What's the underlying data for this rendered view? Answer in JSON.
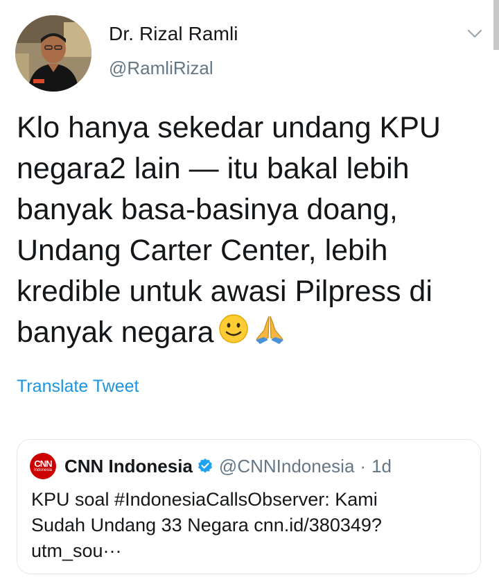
{
  "tweet": {
    "author_name": "Dr. Rizal Ramli",
    "author_handle": "@RamliRizal",
    "text": "Klo hanya sekedar undang KPU\nnegara2 lain — itu bakal lebih\nbanyak basa-basinya doang,\nUndang Carter Center, lebih\nkredible untuk awasi Pilpress di\nbanyak negara",
    "emojis": [
      "slightly-smiling-face",
      "folded-hands"
    ],
    "translate_label": "Translate Tweet"
  },
  "quote": {
    "logo_text": "CNN",
    "logo_subtext": "Indonesia",
    "name": "CNN Indonesia",
    "handle": "@CNNIndonesia",
    "separator": "·",
    "time": "1d",
    "text": "KPU soal #IndonesiaCallsObserver: Kami\nSudah Undang 33 Negara cnn.id/380349?\nutm_sou···"
  },
  "colors": {
    "link": "#1b95e0",
    "secondary_text": "#657786",
    "verified": "#1da1f2",
    "cnn_red": "#cc0000",
    "border": "#e1e8ed"
  },
  "icons": {
    "menu": "chevron-down-icon",
    "verified": "verified-badge-icon"
  }
}
